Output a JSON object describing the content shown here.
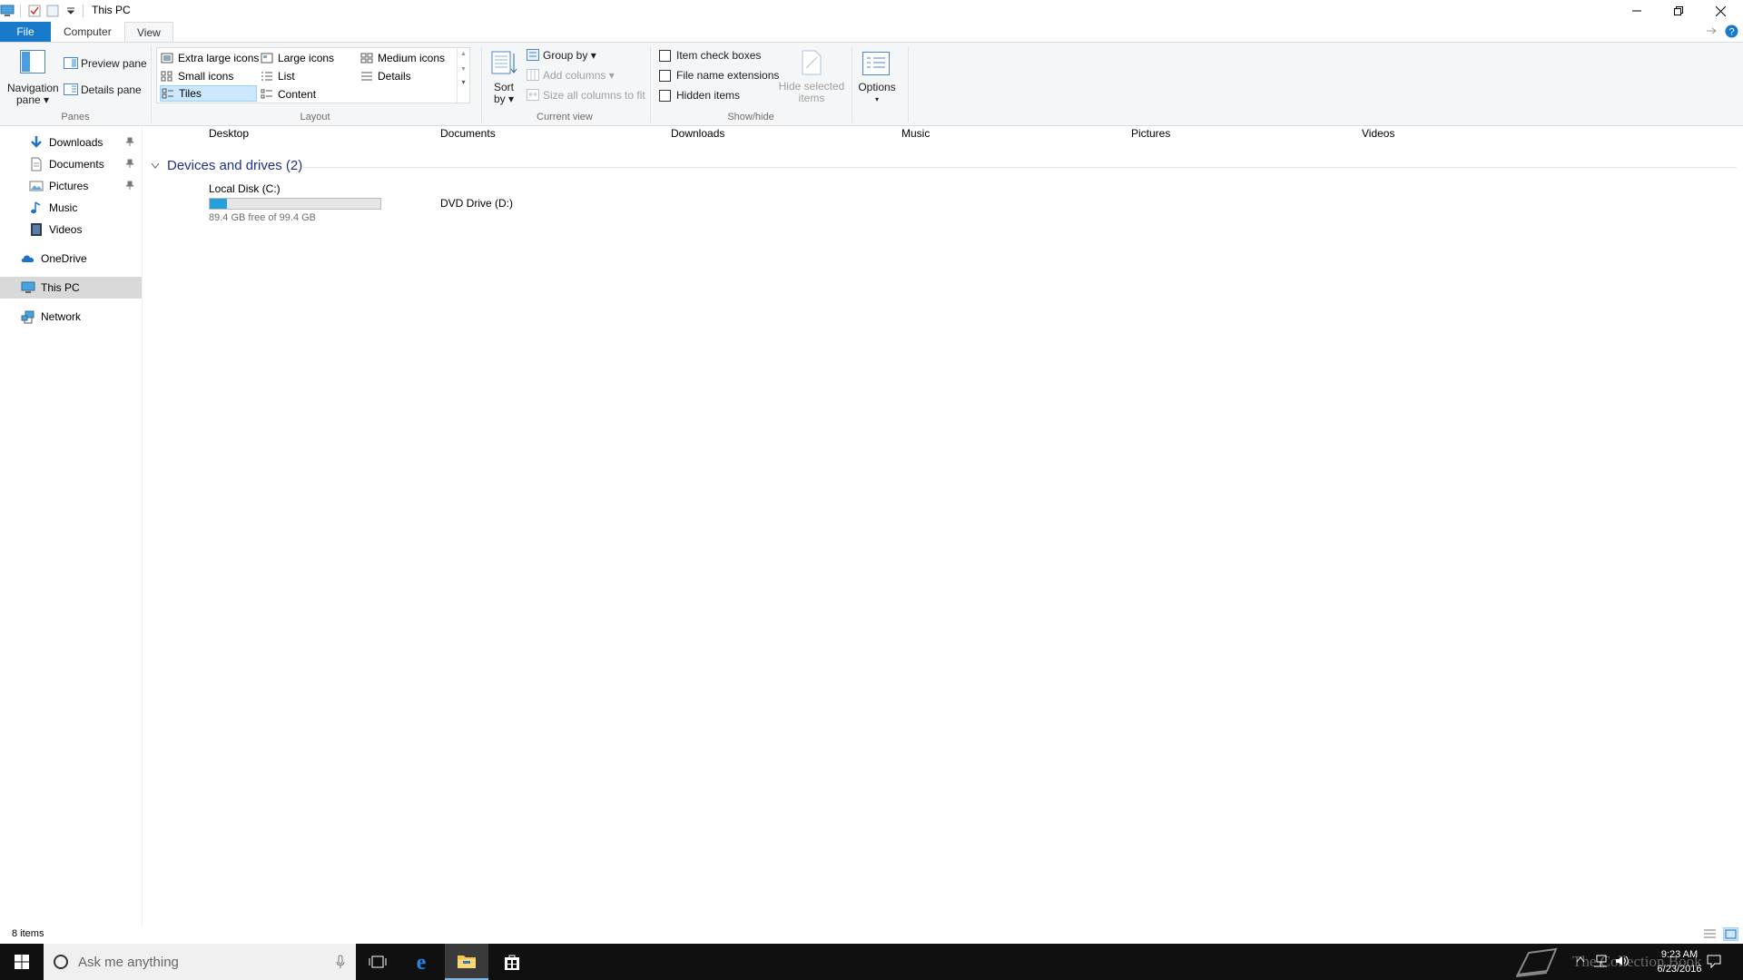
{
  "window": {
    "title": "This PC"
  },
  "tabs": [
    {
      "label": "File"
    },
    {
      "label": "Computer"
    },
    {
      "label": "View"
    }
  ],
  "ribbon": {
    "panes": {
      "navigation_pane": "Navigation",
      "navigation_pane2": "pane",
      "preview_pane": "Preview pane",
      "details_pane": "Details pane",
      "group_label": "Panes"
    },
    "layout": {
      "items": [
        "Extra large icons",
        "Large icons",
        "Medium icons",
        "Small icons",
        "List",
        "Details",
        "Tiles",
        "Content"
      ],
      "selected": "Tiles",
      "group_label": "Layout"
    },
    "current_view": {
      "sort_by": "Sort",
      "sort_by2": "by",
      "group_by": "Group by",
      "add_columns": "Add columns",
      "size_columns": "Size all columns to fit",
      "group_label": "Current view"
    },
    "show_hide": {
      "item_check_boxes": "Item check boxes",
      "file_name_extensions": "File name extensions",
      "hidden_items": "Hidden items",
      "hide_selected": "Hide selected",
      "hide_selected2": "items",
      "group_label": "Show/hide"
    },
    "options": {
      "label": "Options"
    }
  },
  "nav": {
    "items": [
      {
        "label": "Downloads",
        "icon": "download-arrow-icon",
        "pinned": true
      },
      {
        "label": "Documents",
        "icon": "documents-icon",
        "pinned": true
      },
      {
        "label": "Pictures",
        "icon": "pictures-icon",
        "pinned": true
      },
      {
        "label": "Music",
        "icon": "music-icon",
        "pinned": false
      },
      {
        "label": "Videos",
        "icon": "videos-icon",
        "pinned": false
      },
      {
        "label": "OneDrive",
        "icon": "onedrive-icon",
        "pinned": false
      },
      {
        "label": "This PC",
        "icon": "this-pc-icon",
        "pinned": false,
        "selected": true
      },
      {
        "label": "Network",
        "icon": "network-icon",
        "pinned": false
      }
    ]
  },
  "content": {
    "folders": [
      "Desktop",
      "Documents",
      "Downloads",
      "Music",
      "Pictures",
      "Videos"
    ],
    "group_title": "Devices and drives (2)",
    "drives": [
      {
        "name": "Local Disk (C:)",
        "free_text": "89.4 GB free of 99.4 GB",
        "used_fraction": 0.1
      },
      {
        "name": "DVD Drive (D:)"
      }
    ]
  },
  "status": {
    "item_count": "8 items"
  },
  "taskbar": {
    "search_placeholder": "Ask me anything",
    "time": "9:23 AM",
    "date": "6/23/2016",
    "watermark": "The Collection Book"
  },
  "colors": {
    "accent": "#1979ca",
    "selection": "#cce8ff",
    "drive_bar": "#26a0da",
    "group_header": "#1e3287",
    "taskbar": "#101010"
  }
}
